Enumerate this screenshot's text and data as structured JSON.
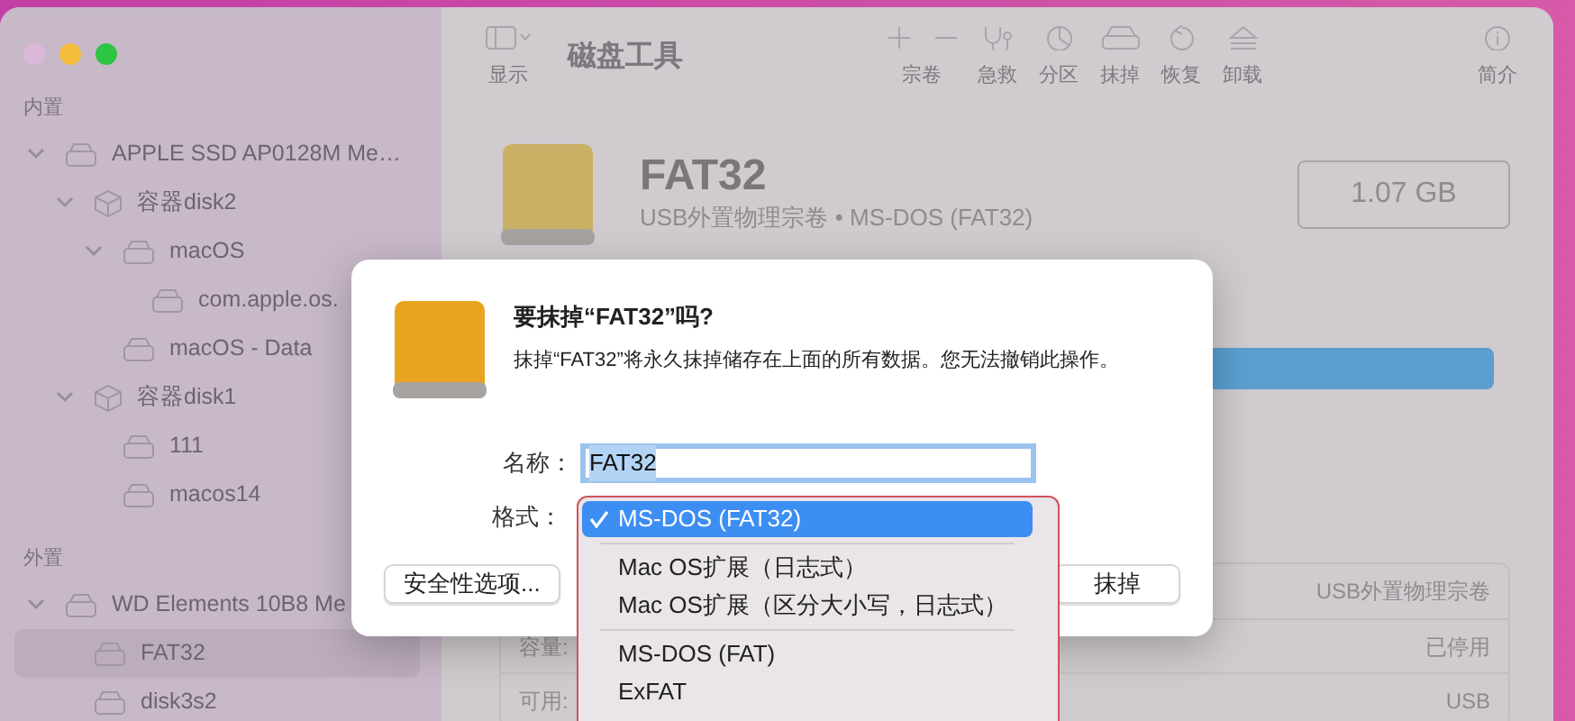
{
  "window": {
    "traffic_lights": [
      {
        "color": "#dcb8d8"
      },
      {
        "color": "#f5bd3c"
      },
      {
        "color": "#2ec544"
      }
    ]
  },
  "toolbar": {
    "view_label": "显示",
    "title": "磁盘工具",
    "actions": [
      {
        "kind": "volume",
        "label": "宗卷"
      },
      {
        "kind": "firstaid",
        "label": "急救"
      },
      {
        "kind": "partition",
        "label": "分区"
      },
      {
        "kind": "erase",
        "label": "抹掉"
      },
      {
        "kind": "restore",
        "label": "恢复"
      },
      {
        "kind": "unmount",
        "label": "卸载"
      },
      {
        "kind": "info",
        "label": "简介"
      }
    ]
  },
  "sidebar": {
    "sections": [
      {
        "title": "内置",
        "items": [
          {
            "kind": "disk",
            "label": "APPLE SSD AP0128M Me…",
            "selected": false,
            "expanded": true,
            "children": [
              {
                "kind": "container",
                "label": "容器disk2",
                "selected": false,
                "expanded": true,
                "children": [
                  {
                    "kind": "volume",
                    "label": "macOS",
                    "selected": false,
                    "expanded": true,
                    "children": [
                      {
                        "kind": "volume",
                        "label": "com.apple.os.",
                        "selected": false
                      }
                    ]
                  },
                  {
                    "kind": "volume",
                    "label": "macOS - Data",
                    "selected": false
                  }
                ]
              },
              {
                "kind": "container",
                "label": "容器disk1",
                "selected": false,
                "expanded": true,
                "children": [
                  {
                    "kind": "volume",
                    "label": "111",
                    "selected": false
                  },
                  {
                    "kind": "volume",
                    "label": "macos14",
                    "selected": false
                  }
                ]
              }
            ]
          }
        ]
      },
      {
        "title": "外置",
        "items": [
          {
            "kind": "disk",
            "label": "WD Elements 10B8 Me",
            "selected": false,
            "expanded": true,
            "children": [
              {
                "kind": "volume",
                "label": "FAT32",
                "selected": true
              },
              {
                "kind": "volume",
                "label": "disk3s2",
                "selected": false
              }
            ]
          }
        ]
      }
    ]
  },
  "detail": {
    "name": "FAT32",
    "subtitle": "USB外置物理宗卷 • MS-DOS (FAT32)",
    "size": "1.07 GB",
    "info_rows": [
      {
        "right_value": "USB外置物理宗卷"
      },
      {
        "left_label": "容量:",
        "right_value": "已停用"
      },
      {
        "left_label": "可用:",
        "right_value": "USB"
      }
    ]
  },
  "dialog": {
    "title": "要抹掉“FAT32”吗?",
    "message": "抹掉“FAT32”将永久抹掉储存在上面的所有数据。您无法撤销此操作。",
    "name_label": "名称：",
    "name_value": "FAT32",
    "format_label": "格式：",
    "buttons": [
      {
        "kind": "left",
        "label": "安全性选项..."
      },
      {
        "kind": "right",
        "label": "抹掉"
      }
    ],
    "format_menu": [
      {
        "kind": "option",
        "label": "MS-DOS (FAT32)",
        "selected": true
      },
      {
        "kind": "separator"
      },
      {
        "kind": "option",
        "label": "Mac OS扩展（日志式）",
        "selected": false
      },
      {
        "kind": "option",
        "label": "Mac OS扩展（区分大小写，日志式）",
        "selected": false
      },
      {
        "kind": "separator"
      },
      {
        "kind": "option",
        "label": "MS-DOS (FAT)",
        "selected": false
      },
      {
        "kind": "option",
        "label": "ExFAT",
        "selected": false
      }
    ]
  }
}
